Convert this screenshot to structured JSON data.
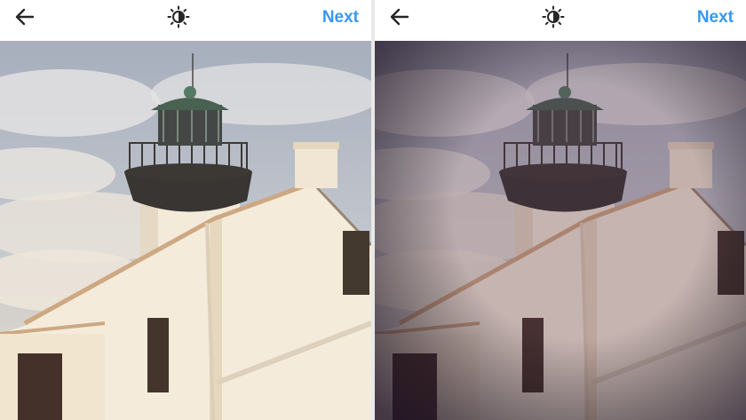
{
  "left_panel": {
    "header": {
      "back_icon": "back-arrow-icon",
      "adjust_icon": "brightness-adjust-icon",
      "next_label": "Next",
      "accent_color": "#3897f0"
    },
    "photo": {
      "filter": "original"
    }
  },
  "right_panel": {
    "header": {
      "back_icon": "back-arrow-icon",
      "adjust_icon": "brightness-adjust-icon",
      "next_label": "Next",
      "accent_color": "#3897f0"
    },
    "photo": {
      "filter": "vignette-warm"
    }
  }
}
